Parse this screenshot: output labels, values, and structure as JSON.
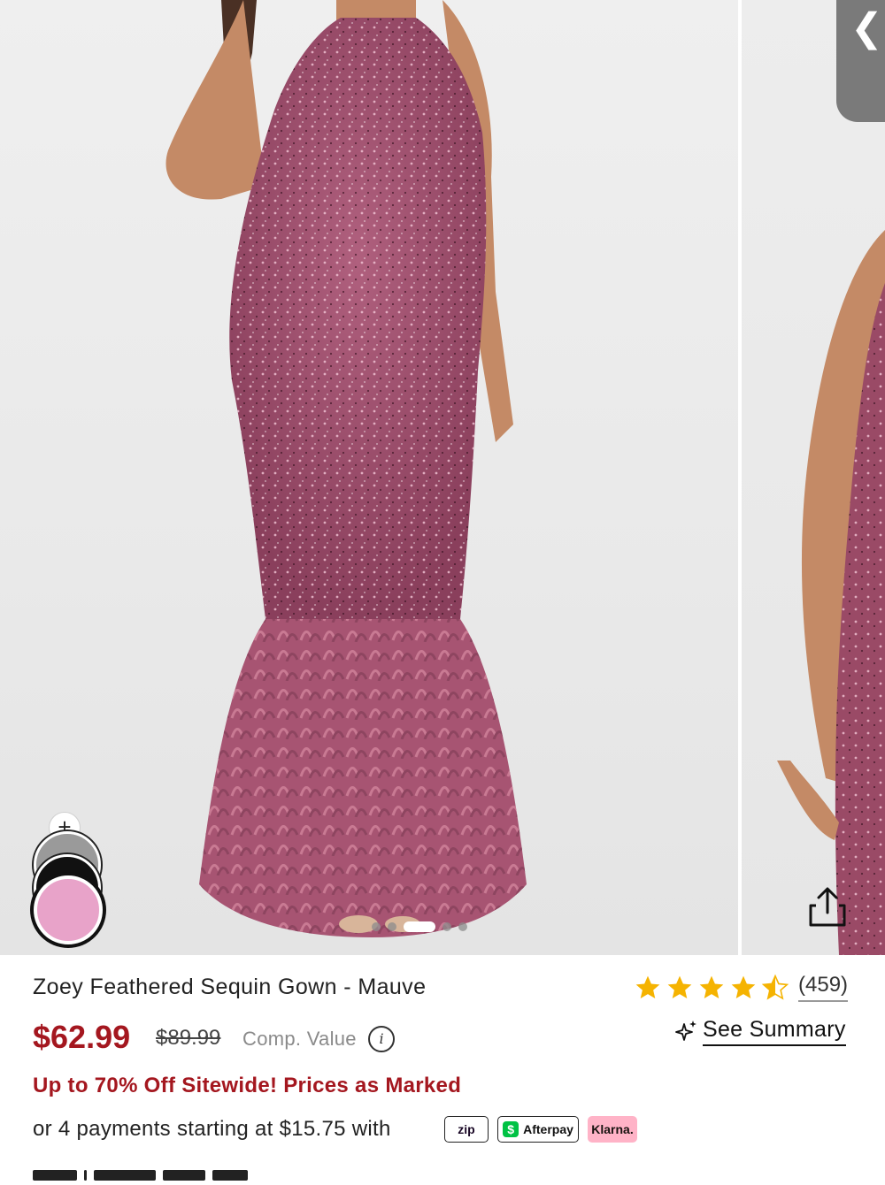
{
  "gallery": {
    "main_image_name": "mauve-feathered-sequin-gown-front",
    "next_image_name": "mauve-feathered-sequin-gown-side",
    "back_label": "❮",
    "add_color_label": "+",
    "swatch_colors": [
      "#9a9a9a",
      "#111111",
      "#e8a3c9"
    ],
    "dot_count": 6,
    "active_dot_index": 3
  },
  "product": {
    "title": "Zoey Feathered Sequin Gown - Mauve",
    "rating_value": 4.5,
    "rating_count": "(459)",
    "see_summary": "See Summary",
    "price": "$62.99",
    "original_price": "$89.99",
    "comp_value": "Comp. Value",
    "info_icon": "i",
    "promo": "Up to 70% Off Sitewide! Prices as Marked",
    "payments": "or 4 payments starting at $15.75 with",
    "zip_label": "zip",
    "afterpay_label": "Afterpay",
    "afterpay_mark": "$",
    "klarna_label": "Klarna."
  },
  "colors": {
    "sale_red": "#a4171f",
    "star_gold": "#f5b301",
    "dress_mauve": "#9a4a66"
  }
}
